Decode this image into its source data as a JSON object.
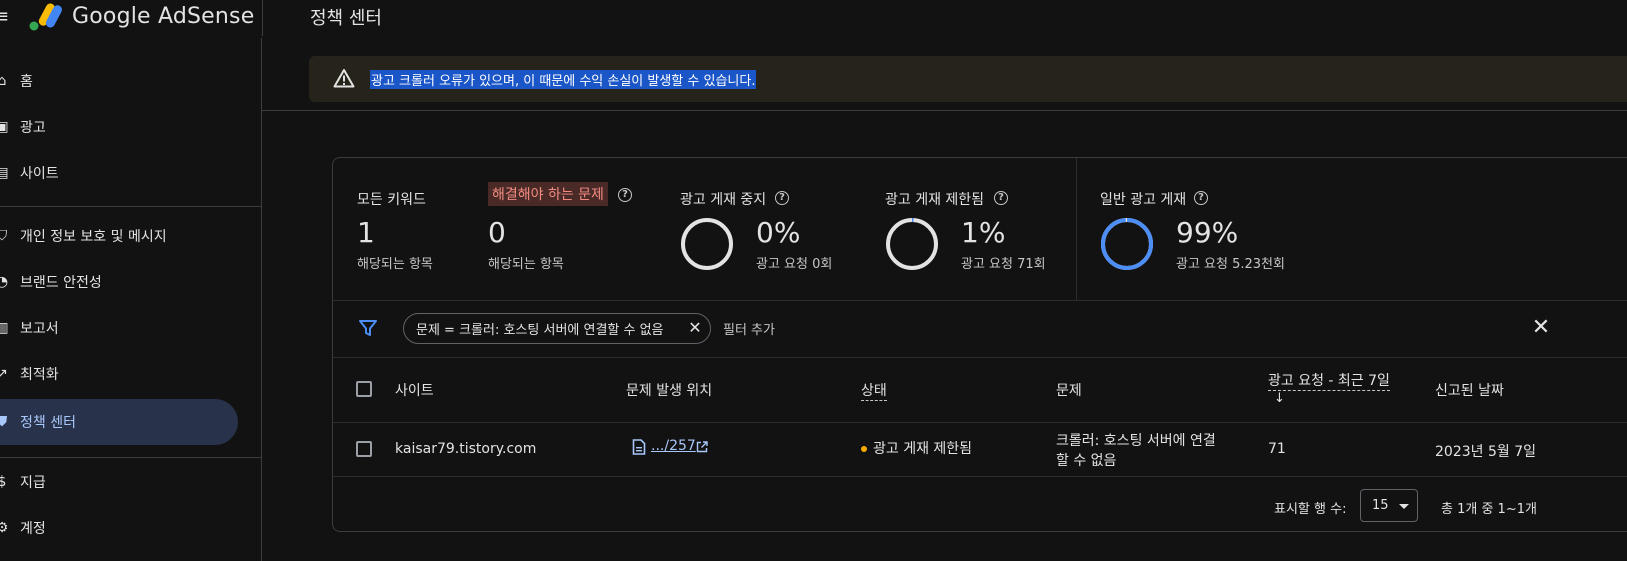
{
  "app": {
    "brand": "Google AdSense",
    "page_title": "정책 센터"
  },
  "sidebar": {
    "items": [
      {
        "label": "홈",
        "icon": "home-icon"
      },
      {
        "label": "광고",
        "icon": "ads-icon"
      },
      {
        "label": "사이트",
        "icon": "sites-icon"
      },
      {
        "label": "개인 정보 보호 및 메시지",
        "icon": "privacy-shield-icon"
      },
      {
        "label": "브랜드 안전성",
        "icon": "brand-safety-icon"
      },
      {
        "label": "보고서",
        "icon": "reports-icon"
      },
      {
        "label": "최적화",
        "icon": "optimization-icon"
      },
      {
        "label": "정책 센터",
        "icon": "policy-center-icon",
        "active": true
      },
      {
        "label": "지급",
        "icon": "payments-icon"
      },
      {
        "label": "계정",
        "icon": "account-gear-icon"
      }
    ]
  },
  "alert": {
    "text": "광고 크롤러 오류가 있으며, 이 때문에 수익 손실이 발생할 수 있습니다.",
    "icon": "warning-icon"
  },
  "summary": {
    "all_keywords": {
      "label": "모든 키워드",
      "value": "1",
      "sub": "해당되는 항목"
    },
    "must_fix": {
      "label": "해결해야 하는 문제",
      "value": "0",
      "sub": "해당되는 항목"
    },
    "ad_serving_disabled": {
      "label": "광고 게재 중지",
      "value": "0%",
      "sub": "광고 요청 0회",
      "fraction": 0.0
    },
    "ad_serving_limited": {
      "label": "광고 게재 제한됨",
      "value": "1%",
      "sub": "광고 요청 71회",
      "fraction": 0.01
    },
    "ad_serving_normal": {
      "label": "일반 광고 게재",
      "value": "99%",
      "sub": "광고 요청 5.23천회",
      "fraction": 0.99
    }
  },
  "filter": {
    "chip_label": "문제 = 크롤러: 호스팅 서버에 연결할 수 없음",
    "add_filter": "필터 추가"
  },
  "table": {
    "headers": {
      "site": "사이트",
      "location": "문제 발생 위치",
      "status": "상태",
      "issue": "문제",
      "requests": "광고 요청 - 최근 7일",
      "sort_arrow": "↓",
      "reported": "신고된 날짜"
    },
    "rows": [
      {
        "site": "kaisar79.tistory.com",
        "location": ".../257",
        "status": "광고 게재 제한됨",
        "issue_line1": "크롤러: 호스팅 서버에 연결",
        "issue_line2": "할 수 없음",
        "requests": "71",
        "reported": "2023년 5월 7일"
      }
    ]
  },
  "pagination": {
    "rows_label": "표시할 행 수:",
    "rows_value": "15",
    "range": "총 1개 중 1~1개"
  },
  "colors": {
    "background": "#121212",
    "accent": "#a8c7fa",
    "ring_normal": "#4c8df6",
    "ring_track": "#e3e3e3",
    "status_limited": "#f9ab00",
    "alert_bg": "#26241a",
    "highlight_label_bg": "#4a2a26",
    "highlight_label_text": "#f28b82"
  }
}
